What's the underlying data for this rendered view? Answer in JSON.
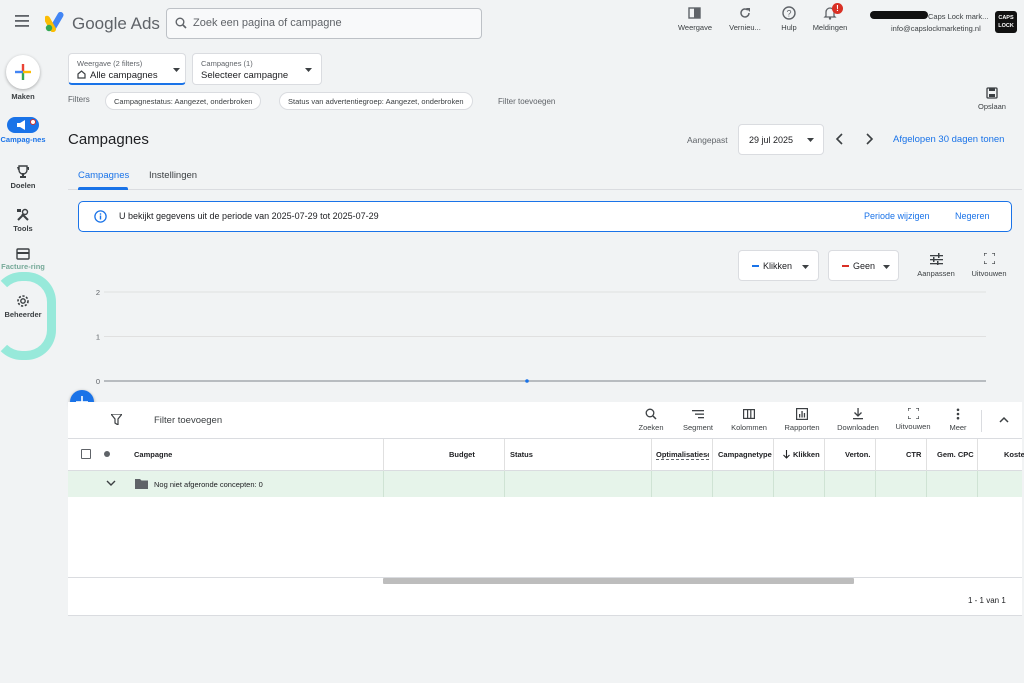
{
  "header": {
    "app_name": "Google Ads",
    "search_placeholder": "Zoek een pagina of campagne",
    "actions": [
      {
        "label": "Weergave",
        "icon": "view-icon"
      },
      {
        "label": "Vernieu...",
        "icon": "refresh-icon"
      },
      {
        "label": "Hulp",
        "icon": "help-icon"
      },
      {
        "label": "Meldingen",
        "icon": "bell-icon",
        "badge": "!"
      }
    ],
    "account_name": "Caps Lock mark...",
    "account_email": "info@capslockmarketing.nl",
    "account_logo_text": "CAPS LOCK"
  },
  "sidebar": {
    "items": [
      {
        "label": "Maken",
        "icon": "plus-icon"
      },
      {
        "label": "Campag-nes",
        "icon": "campaign-icon"
      },
      {
        "label": "Doelen",
        "icon": "trophy-icon"
      },
      {
        "label": "Tools",
        "icon": "tools-icon"
      },
      {
        "label": "Facture-ring",
        "icon": "billing-icon"
      },
      {
        "label": "Beheerder",
        "icon": "gear-icon"
      }
    ]
  },
  "filters_bar": {
    "view_small": "Weergave (2 filters)",
    "view_value": "Alle campagnes",
    "campaigns_small": "Campagnes (1)",
    "campaigns_value": "Selecteer campagne",
    "filters_label": "Filters",
    "chips": [
      "Campagnestatus: Aangezet, onderbroken",
      "Status van advertentiegroep: Aangezet, onderbroken"
    ],
    "add_filter": "Filter toevoegen",
    "save_label": "Opslaan"
  },
  "page": {
    "title": "Campagnes",
    "date_prefix": "Aangepast",
    "date_value": "29 jul 2025",
    "last_30": "Afgelopen 30 dagen tonen",
    "tabs": [
      "Campagnes",
      "Instellingen"
    ]
  },
  "info_banner": {
    "text": "U bekijkt gegevens uit de periode van 2025-07-29 tot 2025-07-29",
    "change_period": "Periode wijzigen",
    "ignore": "Negeren"
  },
  "chart_controls": {
    "metric1": "Klikken",
    "metric2": "Geen",
    "adjust": "Aanpassen",
    "expand": "Uitvouwen",
    "metric1_color": "#1a73e8",
    "metric2_color": "#d93025"
  },
  "chart_data": {
    "type": "line",
    "x": [
      "2025-07-29"
    ],
    "series": [
      {
        "values": [
          0
        ]
      }
    ],
    "ylim": [
      0,
      2
    ],
    "yticks": [
      "2",
      "1",
      "0"
    ]
  },
  "table": {
    "add_filter": "Filter toevoegen",
    "tools": [
      "Zoeken",
      "Segment",
      "Kolommen",
      "Rapporten",
      "Downloaden",
      "Uitvouwen",
      "Meer"
    ],
    "columns": {
      "campaign": "Campagne",
      "budget": "Budget",
      "status": "Status",
      "optimization": "Optimalisatiesc",
      "type": "Campagnetype",
      "clicks": "Klikken",
      "impressions": "Verton.",
      "ctr": "CTR",
      "cpc": "Gem. CPC",
      "cost": "Koste"
    },
    "draft_row": "Nog niet afgeronde concepten: 0",
    "pagination": "1 - 1 van 1"
  }
}
